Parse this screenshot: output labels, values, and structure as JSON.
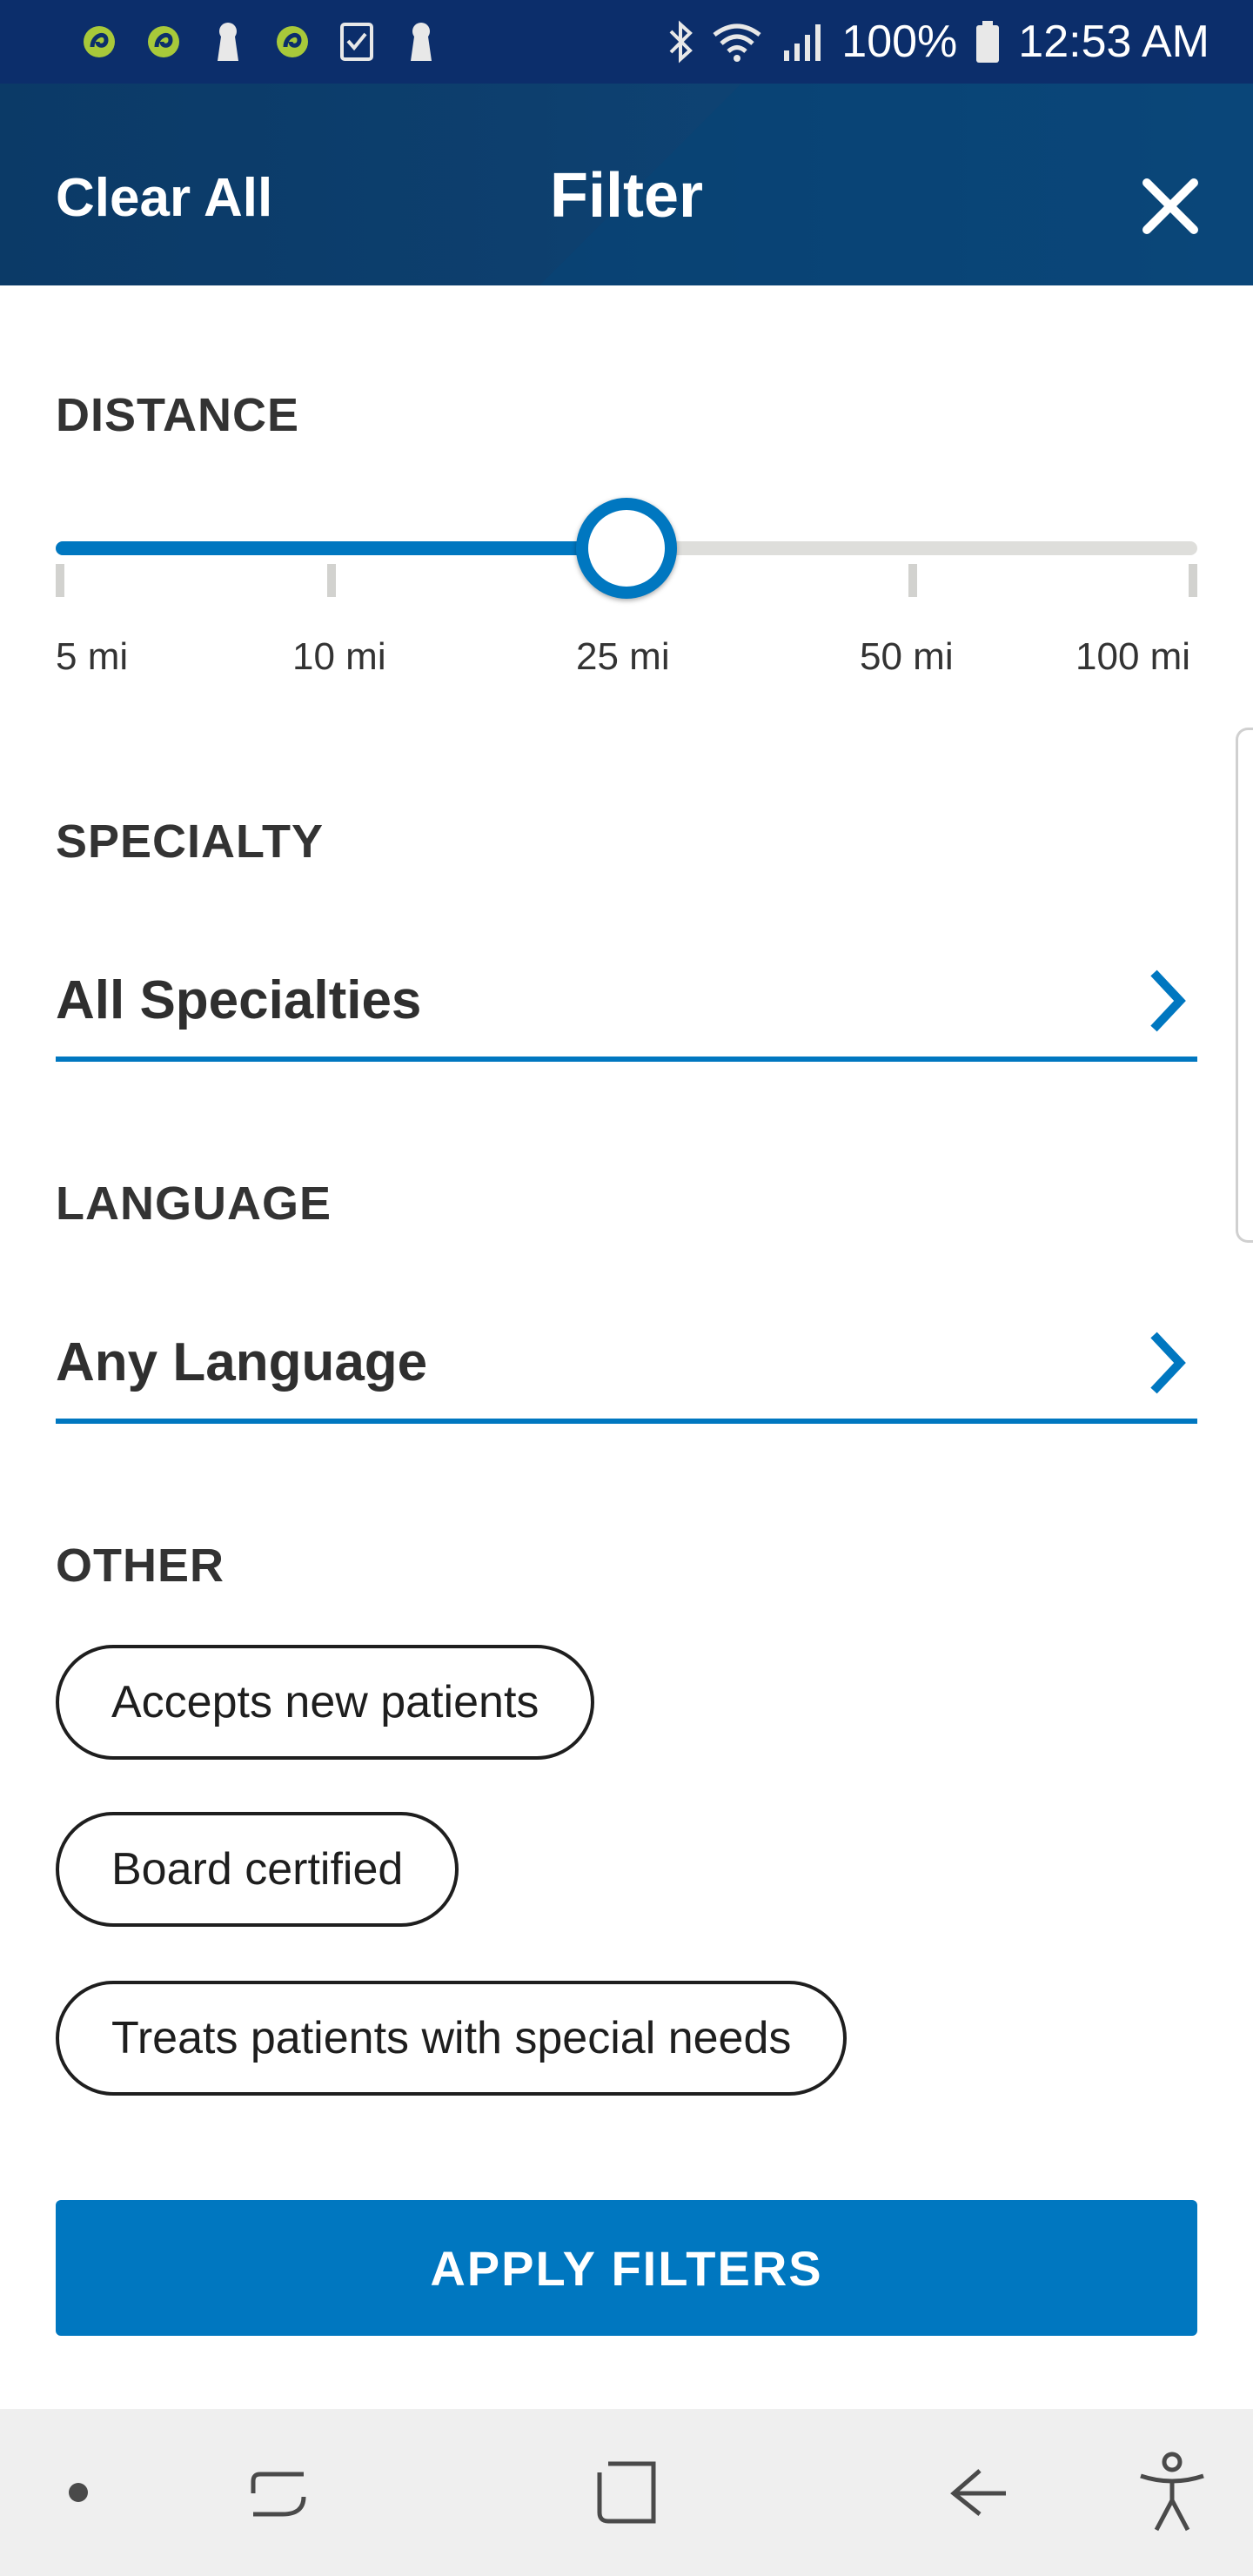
{
  "status_bar": {
    "battery": "100%",
    "time": "12:53 AM",
    "notification_icons": [
      "app-notification-icon",
      "app-notification-icon",
      "keyhole-icon",
      "app-notification-icon",
      "checklist-icon",
      "keyhole-icon"
    ],
    "system_icons": [
      "bluetooth-icon",
      "wifi-icon",
      "signal-icon",
      "battery-icon"
    ]
  },
  "header": {
    "clear_all": "Clear All",
    "title": "Filter",
    "close_icon": "close-icon"
  },
  "distance": {
    "label": "DISTANCE",
    "options": [
      "5 mi",
      "10 mi",
      "25 mi",
      "50 mi",
      "100 mi"
    ],
    "selected": "25 mi",
    "selected_index": 2
  },
  "specialty": {
    "label": "SPECIALTY",
    "value": "All Specialties"
  },
  "language": {
    "label": "LANGUAGE",
    "value": "Any Language"
  },
  "other": {
    "label": "OTHER",
    "chips": [
      "Accepts new patients",
      "Board certified",
      "Treats patients with special needs"
    ]
  },
  "apply_button": "APPLY FILTERS",
  "nav_bar": {
    "items": [
      "dot-icon",
      "recent-apps-icon",
      "home-icon",
      "back-icon",
      "accessibility-icon"
    ]
  },
  "colors": {
    "status_bar": "#0c2e6b",
    "header": "#0b3a67",
    "accent": "#0077c0",
    "text": "#2f2f2f",
    "nav_bar": "#efefef"
  }
}
